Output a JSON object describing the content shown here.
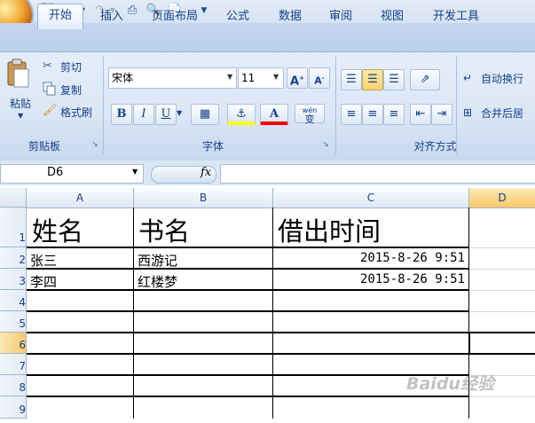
{
  "quick_access": {
    "icons": [
      "save-icon",
      "undo-icon",
      "redo-icon",
      "print-icon",
      "print-preview-icon",
      "new-document-icon",
      "customize-icon"
    ]
  },
  "tabs": [
    "开始",
    "插入",
    "页面布局",
    "公式",
    "数据",
    "审阅",
    "视图",
    "开发工具"
  ],
  "ribbon": {
    "clipboard": {
      "paste": "粘贴",
      "cut": "剪切",
      "copy": "复制",
      "format_painter": "格式刷",
      "label": "剪贴板"
    },
    "font": {
      "font_name": "宋体",
      "font_size": "11",
      "label": "字体",
      "wen": "wén",
      "wen_char": "变"
    },
    "alignment": {
      "wrap_text": "自动换行",
      "merge_center": "合并后居",
      "label": "对齐方式"
    }
  },
  "formula_bar": {
    "name_box": "D6",
    "fx": "fx",
    "formula": ""
  },
  "sheet": {
    "columns": [
      "A",
      "B",
      "C",
      "D"
    ],
    "rows": [
      "1",
      "2",
      "3",
      "4",
      "5",
      "6",
      "7",
      "8",
      "9"
    ],
    "headers": [
      "姓名",
      "书名",
      "借出时间"
    ],
    "data": [
      [
        "张三",
        "西游记",
        "2015-8-26 9:51"
      ],
      [
        "李四",
        "红楼梦",
        "2015-8-26 9:51"
      ]
    ],
    "active_cell": "D6"
  },
  "colors": {
    "ribbon_bg": "#dbe6f5",
    "tab_text": "#15428b",
    "active_header": "#f9d18c"
  },
  "watermark": "Baidu经验"
}
